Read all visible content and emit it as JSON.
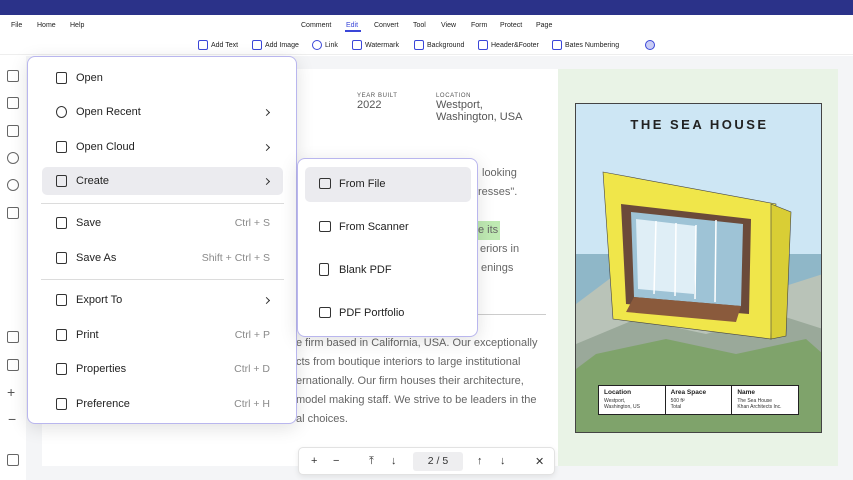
{
  "menubar": {
    "left": [
      "File",
      "Home",
      "Help"
    ],
    "center": [
      "Comment",
      "Edit",
      "Convert",
      "Tool",
      "View",
      "Form",
      "Protect",
      "Page"
    ],
    "active": "Edit"
  },
  "toolbar": {
    "items": [
      {
        "label": "Add Text",
        "icon": "add-text-icon"
      },
      {
        "label": "Add Image",
        "icon": "add-image-icon"
      },
      {
        "label": "Link",
        "icon": "link-icon"
      },
      {
        "label": "Watermark",
        "icon": "watermark-icon"
      },
      {
        "label": "Background",
        "icon": "background-icon"
      },
      {
        "label": "Header&Footer",
        "icon": "header-footer-icon"
      },
      {
        "label": "Bates Numbering",
        "icon": "bates-numbering-icon"
      }
    ]
  },
  "document": {
    "year_built_label": "YEAR BUILT",
    "year_built_value": "2022",
    "location_label": "LOCATION",
    "location_value_1": "Westport,",
    "location_value_2": "Washington, USA",
    "frag_1": "looking",
    "frag_2": "resses\".",
    "frag_3": "e its",
    "frag_4": "eriors in",
    "frag_5": "enings",
    "para_1": "e firm based in California, USA. Our exceptionally",
    "para_2": "cts from boutique interiors to large institutional",
    "para_3": "ernationally. Our firm houses their architecture,",
    "para_4": "model making staff. We strive to be leaders in the",
    "para_5": "al choices."
  },
  "poster": {
    "title": "THE SEA HOUSE",
    "table": [
      {
        "header": "Location",
        "line1": "Westport,",
        "line2": "Washington, US"
      },
      {
        "header": "Area Space",
        "line1": "500 ft²",
        "line2": "Total"
      },
      {
        "header": "Name",
        "line1": "The Sea House",
        "line2": "Khan Architects Inc."
      }
    ]
  },
  "menu": {
    "items": [
      {
        "label": "Open",
        "icon": "open-file-icon",
        "shortcut": "",
        "submenu": false
      },
      {
        "label": "Open Recent",
        "icon": "clock-icon",
        "shortcut": "",
        "submenu": true
      },
      {
        "label": "Open Cloud",
        "icon": "cloud-file-icon",
        "shortcut": "",
        "submenu": true
      },
      {
        "label": "Create",
        "icon": "create-plus-icon",
        "shortcut": "",
        "submenu": true
      },
      {
        "label": "Save",
        "icon": "save-icon",
        "shortcut": "Ctrl + S",
        "submenu": false
      },
      {
        "label": "Save As",
        "icon": "save-as-icon",
        "shortcut": "Shift + Ctrl + S",
        "submenu": false
      },
      {
        "label": "Export To",
        "icon": "export-icon",
        "shortcut": "",
        "submenu": true
      },
      {
        "label": "Print",
        "icon": "printer-icon",
        "shortcut": "Ctrl + P",
        "submenu": false
      },
      {
        "label": "Properties",
        "icon": "properties-list-icon",
        "shortcut": "Ctrl + D",
        "submenu": false
      },
      {
        "label": "Preference",
        "icon": "sliders-icon",
        "shortcut": "Ctrl + H",
        "submenu": false
      }
    ]
  },
  "submenu": {
    "items": [
      {
        "label": "From File",
        "icon": "folder-icon"
      },
      {
        "label": "From Scanner",
        "icon": "scanner-icon"
      },
      {
        "label": "Blank PDF",
        "icon": "blank-page-icon"
      },
      {
        "label": "PDF Portfolio",
        "icon": "portfolio-folder-icon"
      }
    ]
  },
  "pager": {
    "zoom_in": "+",
    "zoom_out": "−",
    "page_display": "2 / 5",
    "close": "✕"
  },
  "colors": {
    "topbar": "#2b3289",
    "accent": "#3a46d8",
    "menu_border": "#b9b6ee",
    "highlight": "#bfeab3"
  }
}
